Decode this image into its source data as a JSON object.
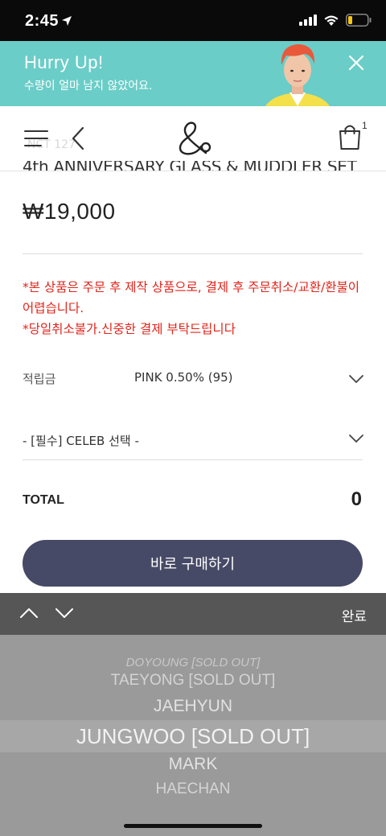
{
  "status_bar": {
    "time": "2:45"
  },
  "banner": {
    "title": "Hurry Up!",
    "subtitle": "수량이 얼마 남지 않았어요."
  },
  "header": {
    "cart_count": "1",
    "brand_ghost": "NCT 127"
  },
  "product": {
    "title": "4th ANNIVERSARY GLASS & MUDDLER SET",
    "price": "₩19,000",
    "notice_line1": "*본 상품은 주문 후 제작 상품으로, 결제 후 주문취소/교환/환불이 어렵습니다.",
    "notice_line2": "*당일취소불가.신중한 결제 부탁드립니다"
  },
  "points": {
    "label": "적립금",
    "value": "PINK 0.50% (95)"
  },
  "celeb_select": {
    "value": "- [필수] CELEB 선택 -"
  },
  "total": {
    "label": "TOTAL",
    "value": "0"
  },
  "buy_button": {
    "label": "바로 구매하기"
  },
  "picker": {
    "done_label": "완료",
    "items": [
      "DOYOUNG [SOLD OUT]",
      "TAEYONG [SOLD OUT]",
      "JAEHYUN",
      "JUNGWOO [SOLD OUT]",
      "MARK",
      "HAECHAN"
    ],
    "selected": "JUNGWOO [SOLD OUT]"
  },
  "colors": {
    "banner": "#6bcdc7",
    "button": "#474a66",
    "notice": "#e2231a",
    "picker_bar": "#565656",
    "picker_wheel": "#9a9a9a"
  }
}
